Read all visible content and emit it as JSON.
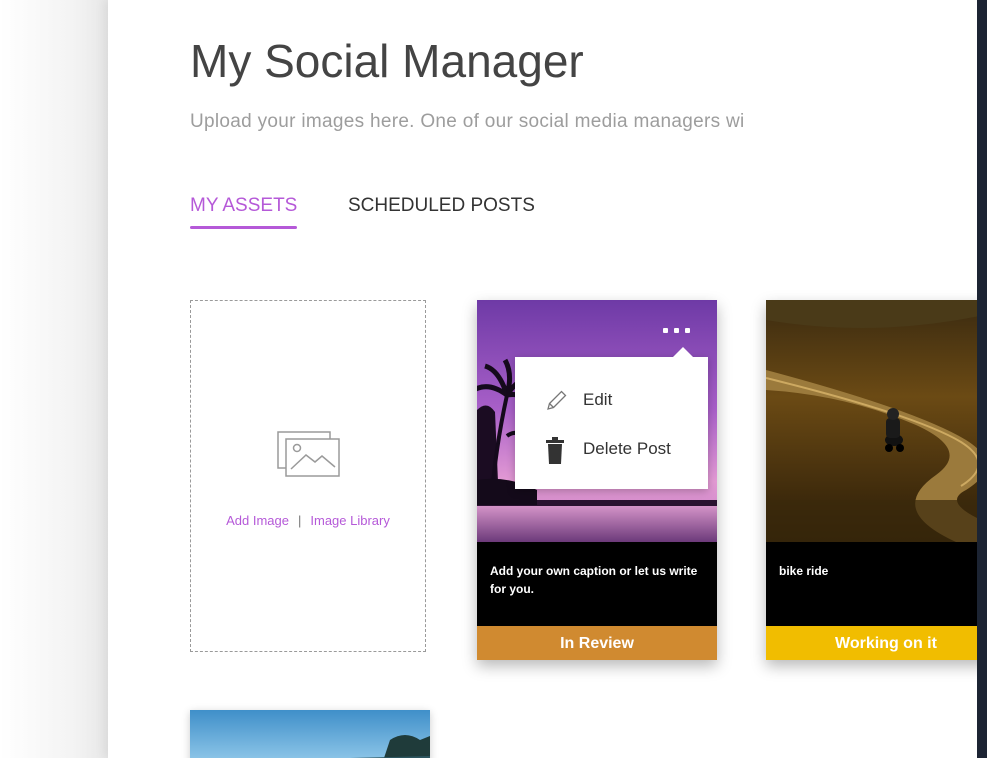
{
  "header": {
    "title": "My Social Manager",
    "subtitle": "Upload your images here. One of our social media managers wi"
  },
  "tabs": [
    {
      "label": "MY ASSETS",
      "active": true
    },
    {
      "label": "SCHEDULED POSTS",
      "active": false
    }
  ],
  "add_box": {
    "add_image_label": "Add Image",
    "separator": "|",
    "image_library_label": "Image Library",
    "icon": "image-placeholder-icon"
  },
  "context_menu": {
    "items": [
      {
        "label": "Edit",
        "icon": "pencil-icon"
      },
      {
        "label": "Delete Post",
        "icon": "trash-icon"
      }
    ]
  },
  "cards": [
    {
      "caption": "Add your own caption or let us write for you.",
      "status": "In Review",
      "status_color": "#d08a30",
      "image": "palm-sunset-photo"
    },
    {
      "caption": "bike ride",
      "status": "Working on it",
      "status_color": "#f1bd00",
      "image": "motorcycle-road-photo"
    }
  ],
  "colors": {
    "accent": "#b559d8",
    "title_text": "#444444",
    "subtitle_text": "#9d9d9d",
    "frame_background": "#1c2433"
  }
}
